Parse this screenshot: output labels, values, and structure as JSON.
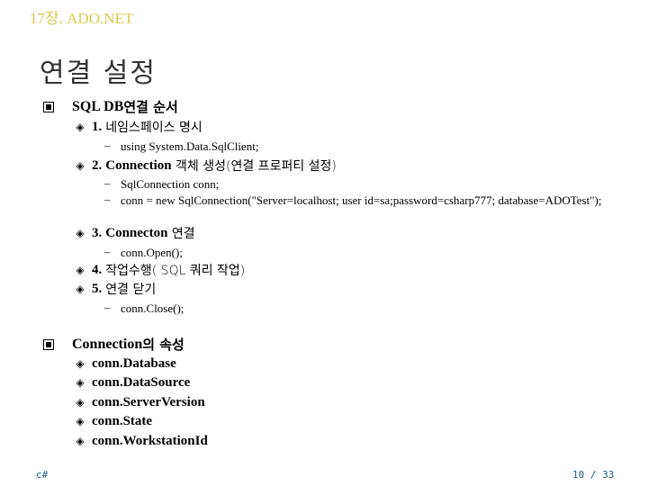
{
  "header": {
    "chapter": "17장. ADO.NET"
  },
  "title": "연결 설정",
  "sections": [
    {
      "heading_en": "SQL DB ",
      "heading_ko": "연결 순서",
      "steps": [
        {
          "num": "1.",
          "label_en": "",
          "label_ko": "네임스페이스 명시",
          "code": [
            "using System.Data.SqlClient;"
          ]
        },
        {
          "num": "2.",
          "label_en": "Connection",
          "label_ko": " 객체 생성(연결 프로퍼티 설정)",
          "code": [
            "SqlConnection conn;",
            "conn = new SqlConnection(\"Server=localhost; user id=sa;password=csharp777; database=ADOTest\");"
          ]
        },
        {
          "num": "3.",
          "label_en": "Connecton",
          "label_ko": " 연결",
          "code": [
            "conn.Open();"
          ]
        },
        {
          "num": "4.",
          "label_en": "",
          "label_ko": "작업수행( SQL 쿼리 작업)",
          "code": []
        },
        {
          "num": "5.",
          "label_en": "",
          "label_ko": "연결 닫기",
          "code": [
            "conn.Close();"
          ]
        }
      ]
    },
    {
      "heading_en": "Connection",
      "heading_ko": "의 속성",
      "properties": [
        "conn.Database",
        "conn.DataSource",
        "conn.ServerVersion",
        "conn.State",
        "conn.WorkstationId"
      ]
    }
  ],
  "glyphs": {
    "section_bullet": "square-bullet-icon",
    "item_bullet": "◈",
    "dash": "–"
  },
  "footer": {
    "left": "c#",
    "page": "10 / 33"
  },
  "colors": {
    "header": "#d9c94a",
    "footer": "#1f5f8a"
  }
}
